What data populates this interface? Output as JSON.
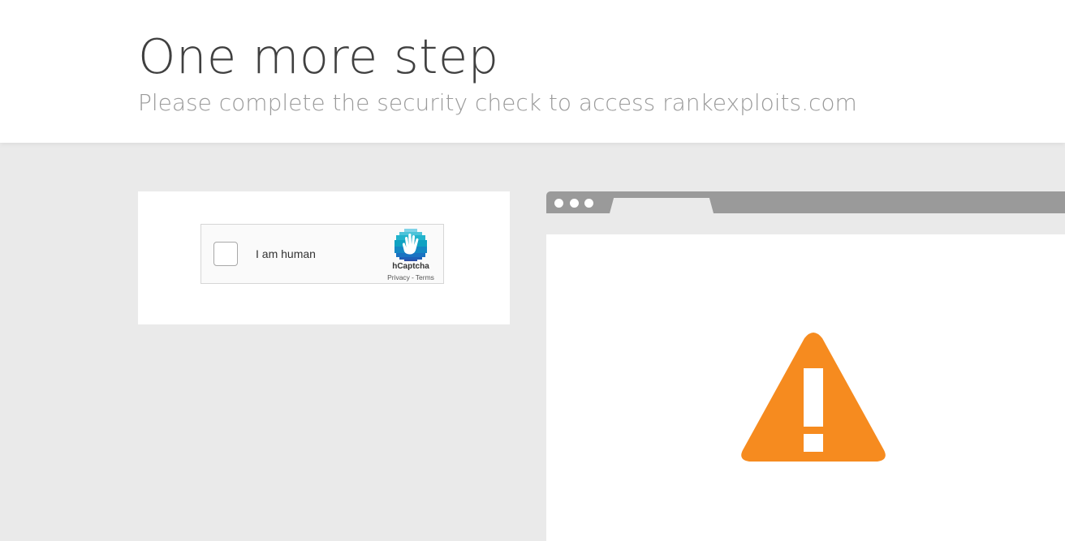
{
  "header": {
    "title": "One more step",
    "subtitle": "Please complete the security check to access rankexploits.com"
  },
  "captcha": {
    "label": "I am human",
    "brand": "hCaptcha",
    "privacy_link": "Privacy",
    "separator": "-",
    "terms_link": "Terms",
    "checked": false
  },
  "illustration": {
    "icon": "warning-icon",
    "colors": {
      "warning": "#f68b1f",
      "browser_chrome": "#9a9a9a"
    }
  }
}
